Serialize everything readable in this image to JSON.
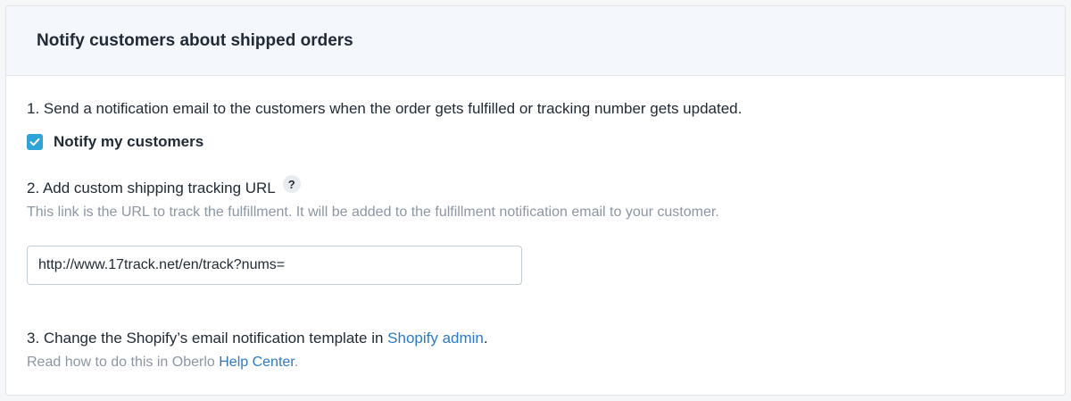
{
  "card": {
    "title": "Notify customers about shipped orders"
  },
  "step1": {
    "text": "1. Send a notification email to the customers when the order gets fulfilled or tracking number gets updated.",
    "checkbox_label": "Notify my customers",
    "checked": true
  },
  "step2": {
    "text": "2. Add custom shipping tracking URL",
    "help_icon_glyph": "?",
    "description": "This link is the URL to track the fulfillment. It will be added to the fulfillment notification email to your customer.",
    "url_value": "http://www.17track.net/en/track?nums="
  },
  "step3": {
    "text_prefix": "3. Change the Shopify’s email notification template in ",
    "link": "Shopify admin",
    "text_suffix": ".",
    "note_prefix": "Read how to do this in Oberlo ",
    "note_link": "Help Center",
    "note_suffix": "."
  },
  "colors": {
    "accent": "#2ea3d6",
    "link": "#2c7bc4",
    "muted_text": "#8c96a3",
    "header_bg": "#f4f7fb"
  },
  "icons": {
    "checkbox": "checkmark-icon",
    "help": "question-mark-icon"
  }
}
